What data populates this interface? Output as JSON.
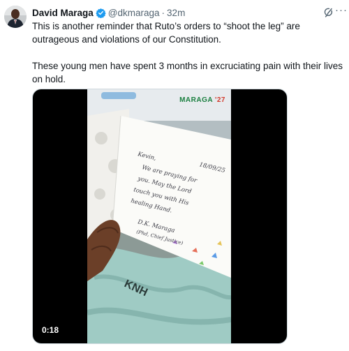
{
  "tweet": {
    "author_name": "David Maraga",
    "handle": "@dkmaraga",
    "separator": "·",
    "time": "32m",
    "text_p1": "This is another reminder that Ruto’s orders to “shoot the leg” are outrageous and violations of our Constitution.",
    "text_p2": "These young men have spent 3 months in excruciating pain with their lives on hold."
  },
  "media": {
    "logo_name": "MARAGA",
    "logo_year": "'27",
    "duration": "0:18",
    "gown_text": "KNH",
    "card_text": [
      "Kevin,",
      "We are praying for",
      "you. May the Lord",
      "touch you with His",
      "healing Hand.",
      "D.K. Maraga",
      "(Phd, Chief Justice)"
    ],
    "card_date": "18/09/25"
  },
  "colors": {
    "verified": "#1d9bf0",
    "secondary_text": "#536471"
  },
  "icons": [
    "verified-badge-icon",
    "grok-icon",
    "more-options-icon"
  ]
}
